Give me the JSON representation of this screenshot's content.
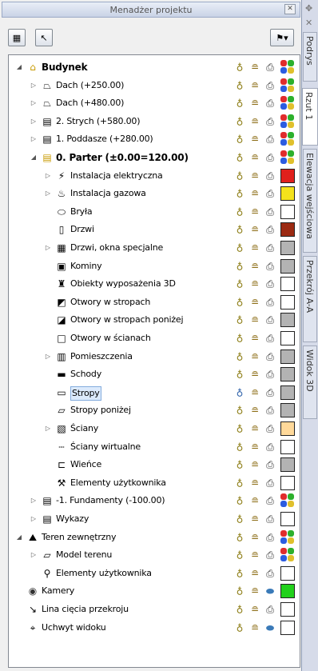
{
  "panel": {
    "title": "Menadżer projektu",
    "close_icon": "close-icon",
    "toolbar": {
      "left_buttons": [
        "add-storey-icon",
        "cursor-icon"
      ],
      "right_button": "filter-dropdown-icon"
    }
  },
  "tree": [
    {
      "level": 0,
      "expander": "open",
      "icon": "building-icon",
      "label": "Budynek",
      "bold": true,
      "swatch": "multi"
    },
    {
      "level": 1,
      "expander": "closed",
      "icon": "roof-icon",
      "label": "Dach (+250.00)",
      "swatch": "multi"
    },
    {
      "level": 1,
      "expander": "closed",
      "icon": "roof-icon",
      "label": "Dach (+480.00)",
      "swatch": "multi"
    },
    {
      "level": 1,
      "expander": "closed",
      "icon": "storey-icon",
      "label": "2. Strych (+580.00)",
      "swatch": "multi"
    },
    {
      "level": 1,
      "expander": "closed",
      "icon": "storey-icon",
      "label": "1. Poddasze (+280.00)",
      "swatch": "multi"
    },
    {
      "level": 1,
      "expander": "open",
      "icon": "storey-active-icon",
      "label": "0. Parter (±0.00=120.00)",
      "bold": true,
      "swatch": "multi"
    },
    {
      "level": 2,
      "expander": "closed",
      "icon": "electrical-icon",
      "label": "Instalacja elektryczna",
      "swatch": "#e0201c"
    },
    {
      "level": 2,
      "expander": "closed",
      "icon": "gas-icon",
      "label": "Instalacja gazowa",
      "swatch": "#f4e21c"
    },
    {
      "level": 2,
      "icon": "solid-icon",
      "label": "Bryła",
      "swatch": "#ffffff"
    },
    {
      "level": 2,
      "icon": "door-icon",
      "label": "Drzwi",
      "swatch": "#9b2a12"
    },
    {
      "level": 2,
      "expander": "closed",
      "icon": "window-icon",
      "label": "Drzwi, okna specjalne",
      "swatch": "#b3b3b3"
    },
    {
      "level": 2,
      "icon": "chimney-icon",
      "label": "Kominy",
      "swatch": "#b3b3b3"
    },
    {
      "level": 2,
      "icon": "furniture-icon",
      "label": "Obiekty wyposażenia 3D",
      "swatch": "#ffffff"
    },
    {
      "level": 2,
      "icon": "ceiling-opening-icon",
      "label": "Otwory w stropach",
      "swatch": "#ffffff"
    },
    {
      "level": 2,
      "icon": "ceiling-opening-below-icon",
      "label": "Otwory w stropach poniżej",
      "swatch": "#b3b3b3"
    },
    {
      "level": 2,
      "icon": "wall-opening-icon",
      "label": "Otwory w ścianach",
      "swatch": "#ffffff"
    },
    {
      "level": 2,
      "expander": "closed",
      "icon": "room-icon",
      "label": "Pomieszczenia",
      "swatch": "#b3b3b3"
    },
    {
      "level": 2,
      "icon": "stairs-icon",
      "label": "Schody",
      "swatch": "#b3b3b3"
    },
    {
      "level": 2,
      "icon": "slab-icon",
      "label": "Stropy",
      "selected": true,
      "bulb_on": true,
      "swatch": "#b3b3b3"
    },
    {
      "level": 2,
      "icon": "slab-below-icon",
      "label": "Stropy poniżej",
      "swatch": "#b3b3b3"
    },
    {
      "level": 2,
      "expander": "closed",
      "icon": "walls-icon",
      "label": "Ściany",
      "swatch": "#ffd99a"
    },
    {
      "level": 2,
      "icon": "virtual-wall-icon",
      "label": "Ściany wirtualne",
      "swatch": "#ffffff"
    },
    {
      "level": 2,
      "icon": "ring-beam-icon",
      "label": "Wieńce",
      "swatch": "#b3b3b3"
    },
    {
      "level": 2,
      "icon": "user-elements-icon",
      "label": "Elementy użytkownika",
      "swatch": "#ffffff"
    },
    {
      "level": 1,
      "expander": "closed",
      "icon": "storey-icon",
      "label": "-1. Fundamenty (-100.00)",
      "swatch": "multi"
    },
    {
      "level": 1,
      "expander": "closed",
      "icon": "list-icon",
      "label": "Wykazy",
      "swatch": "#ffffff"
    },
    {
      "level": 0,
      "expander": "open",
      "icon": "terrain-icon",
      "label": "Teren zewnętrzny",
      "swatch": "multi"
    },
    {
      "level": 1,
      "expander": "closed",
      "icon": "terrain-model-icon",
      "label": "Model terenu",
      "swatch": "multi"
    },
    {
      "level": 1,
      "icon": "user-elements-outline-icon",
      "label": "Elementy użytkownika",
      "swatch": "#ffffff"
    },
    {
      "level": 0,
      "icon": "cameras-icon",
      "label": "Kamery",
      "print": "eraser",
      "swatch": "#22d11c"
    },
    {
      "level": 0,
      "icon": "section-line-icon",
      "label": "Lina cięcia przekroju",
      "swatch": "#ffffff"
    },
    {
      "level": 0,
      "icon": "view-handle-icon",
      "label": "Uchwyt widoku",
      "print": "eraser",
      "swatch": "#ffffff"
    }
  ],
  "side_tabs": [
    {
      "label": "Podrys",
      "active": false
    },
    {
      "label": "Rzut 1",
      "active": true
    },
    {
      "label": "Elewacja wejściowa",
      "active": false
    },
    {
      "label": "Przekrój A-A",
      "active": false
    },
    {
      "label": "Widok 3D",
      "active": false
    }
  ],
  "multi_colors": [
    "#e02c2c",
    "#2cb02c",
    "#2c5ce0",
    "#e0c02c"
  ]
}
